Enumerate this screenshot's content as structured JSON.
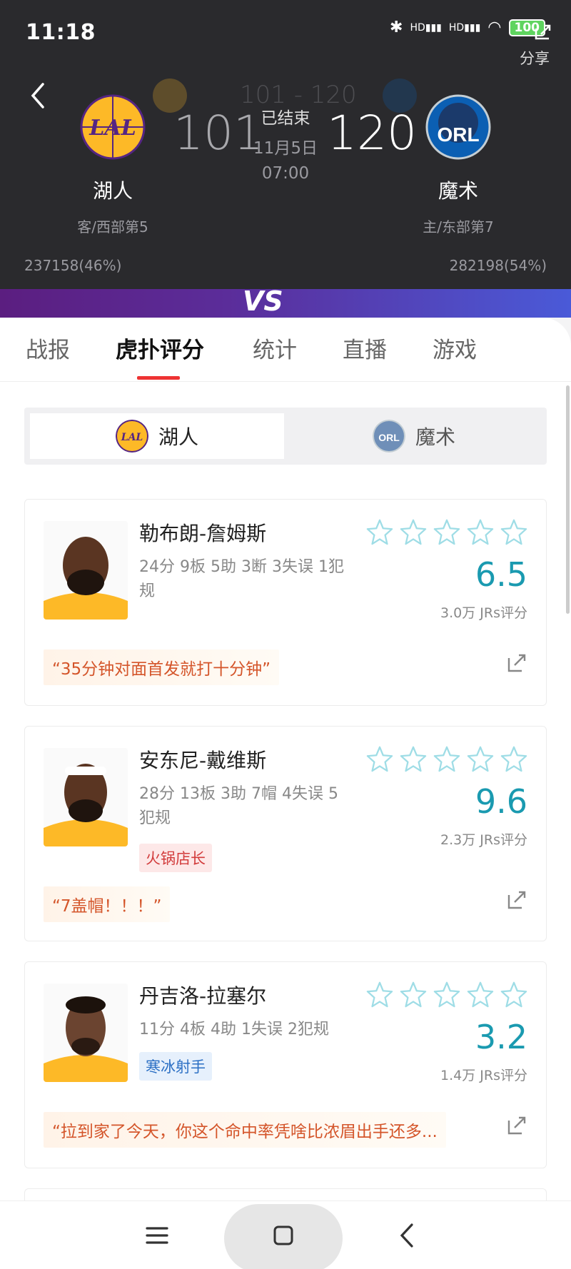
{
  "status_bar": {
    "time": "11:18",
    "battery": "100",
    "signal_label": "HD"
  },
  "header": {
    "share_label": "分享",
    "ghost_score": "101 - 120",
    "away": {
      "name": "湖人",
      "abbr": "LAL",
      "score": "101",
      "rank": "客/西部第5",
      "votes": "237158(46%)",
      "color": "#552583",
      "accent": "#fdb927"
    },
    "home": {
      "name": "魔术",
      "abbr": "ORL",
      "score": "120",
      "rank": "主/东部第7",
      "votes": "282198(54%)",
      "color": "#0b5fb3",
      "accent": "#c4ced4"
    },
    "status": "已结束",
    "date": "11月5日",
    "time": "07:00",
    "vs": "VS"
  },
  "tabs": [
    {
      "label": "战报"
    },
    {
      "label": "虎扑评分"
    },
    {
      "label": "统计"
    },
    {
      "label": "直播"
    },
    {
      "label": "游戏"
    }
  ],
  "team_switch": {
    "left": "湖人",
    "right": "魔术"
  },
  "players": [
    {
      "name": "勒布朗-詹姆斯",
      "stats": "24分 9板 5助 3断 3失误 1犯规",
      "rating": "6.5",
      "voters": "3.0万 JRs评分",
      "quote": "“35分钟对面首发就打十分钟”",
      "tag": ""
    },
    {
      "name": "安东尼-戴维斯",
      "stats": "28分 13板 3助 7帽 4失误 5犯规",
      "rating": "9.6",
      "voters": "2.3万 JRs评分",
      "quote": "“7盖帽！！！”",
      "tag": "火锅店长"
    },
    {
      "name": "丹吉洛-拉塞尔",
      "stats": "11分 4板 4助 1失误 2犯规",
      "rating": "3.2",
      "voters": "1.4万 JRs评分",
      "quote": "“拉到家了今天，你这个命中率凭啥比浓眉出手还多...",
      "tag": "寒冰射手"
    }
  ],
  "colors": {
    "rating": "#1a9ab0",
    "tab_underline": "#e33333",
    "quote": "#d4552a",
    "star": "#9fdde6"
  }
}
